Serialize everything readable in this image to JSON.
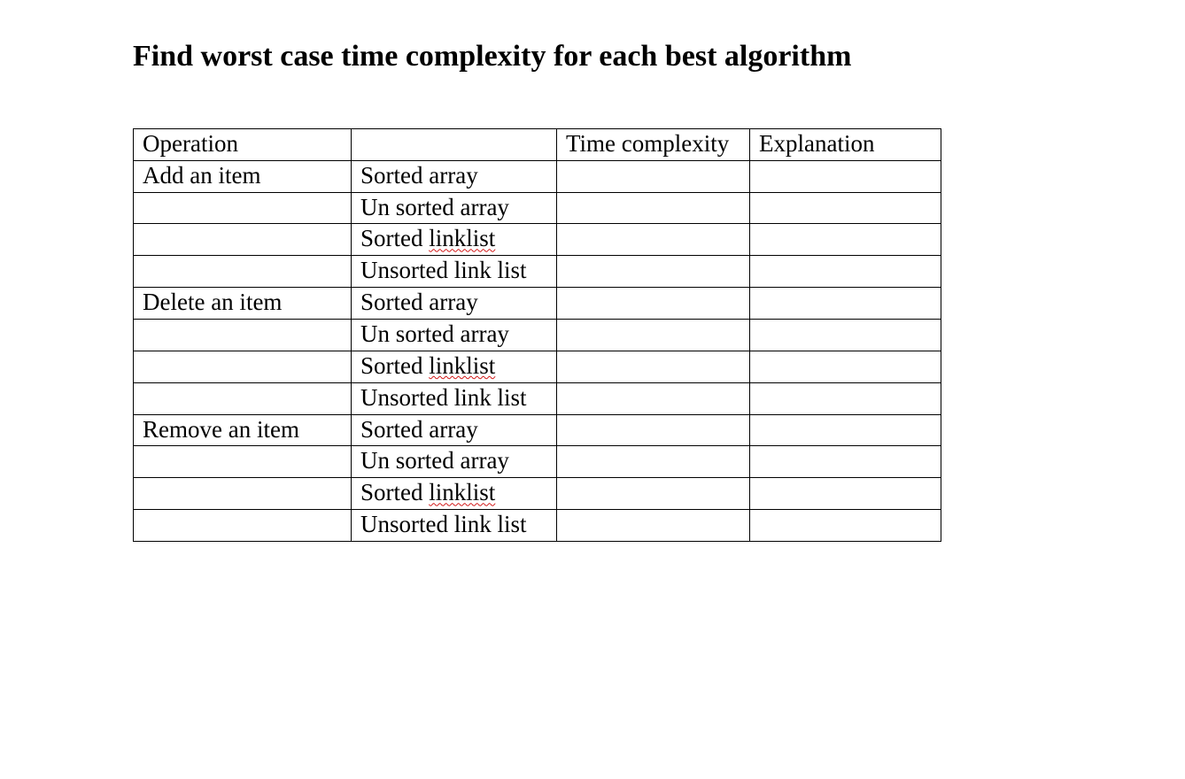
{
  "title": "Find worst case time complexity for each best algorithm",
  "table": {
    "headers": {
      "h0": "Operation",
      "h1": "",
      "h2": "Time complexity",
      "h3": "Explanation"
    },
    "ops": [
      "Add an item",
      "Delete an item",
      "Remove an item"
    ],
    "ds": {
      "sorted_array": "Sorted array",
      "unsorted_array": "Un sorted array",
      "sorted_linklist_pre": "Sorted ",
      "sorted_linklist_squig": "linklist",
      "unsorted_linklist": "Unsorted link list"
    }
  }
}
